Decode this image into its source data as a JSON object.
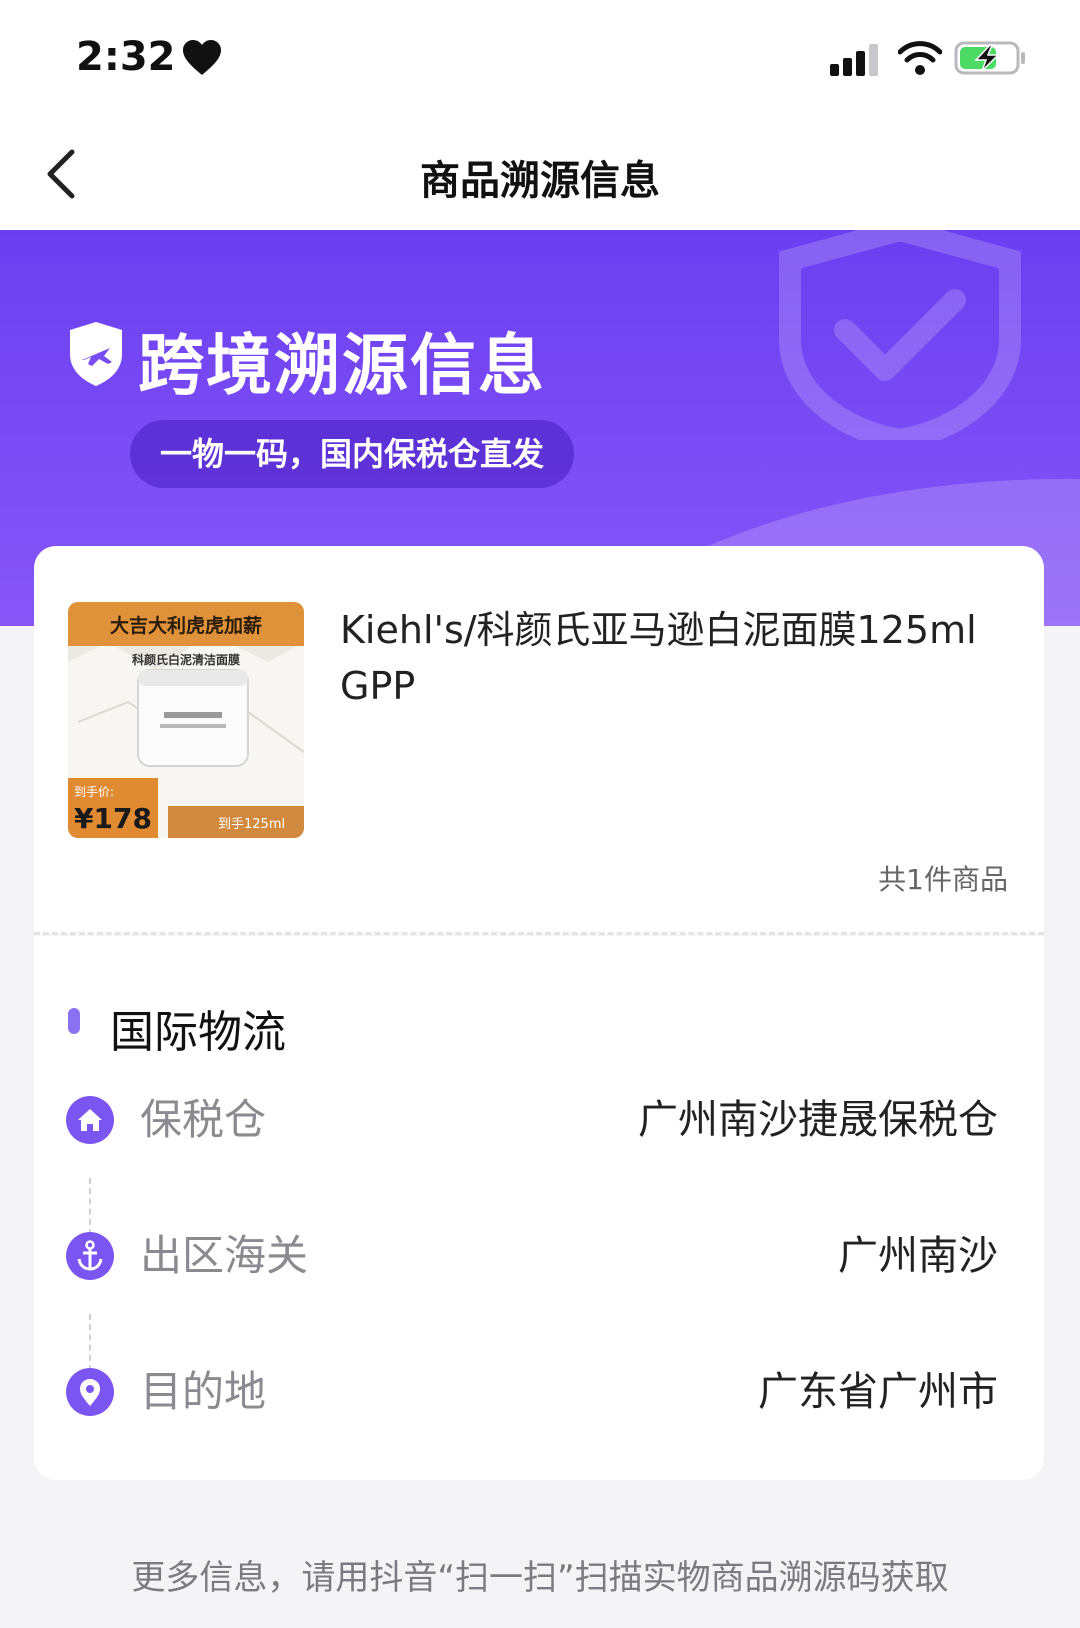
{
  "status_bar": {
    "time": "2:32",
    "icons": [
      "heart-icon",
      "signal-icon",
      "wifi-icon",
      "battery-charging-icon"
    ]
  },
  "nav": {
    "title": "商品溯源信息",
    "back_icon": "chevron-left-icon"
  },
  "hero": {
    "title": "跨境溯源信息",
    "subtitle": "一物一码，国内保税仓直发",
    "icon": "shield-plane-icon"
  },
  "product": {
    "name": "Kiehl's/科颜氏亚马逊白泥面膜125ml GPP",
    "count_text": "共1件商品",
    "image": {
      "banner": "大吉大利虎虎加薪",
      "caption": "科颜氏白泥清洁面膜",
      "price_label": "到手价:",
      "price": "¥178",
      "volume": "到手125ml"
    }
  },
  "logistics": {
    "title": "国际物流",
    "steps": [
      {
        "label": "保税仓",
        "value": "广州南沙捷晟保税仓",
        "icon": "home-icon"
      },
      {
        "label": "出区海关",
        "value": "广州南沙",
        "icon": "anchor-icon"
      },
      {
        "label": "目的地",
        "value": "广东省广州市",
        "icon": "location-pin-icon"
      }
    ]
  },
  "footer": {
    "note": "更多信息，请用抖音“扫一扫”扫描实物商品溯源码获取"
  },
  "colors": {
    "accent": "#7a4cf5",
    "hero_start": "#6b3ff0",
    "icon_purple": "#7b55f0",
    "background": "#f4f4f7"
  }
}
